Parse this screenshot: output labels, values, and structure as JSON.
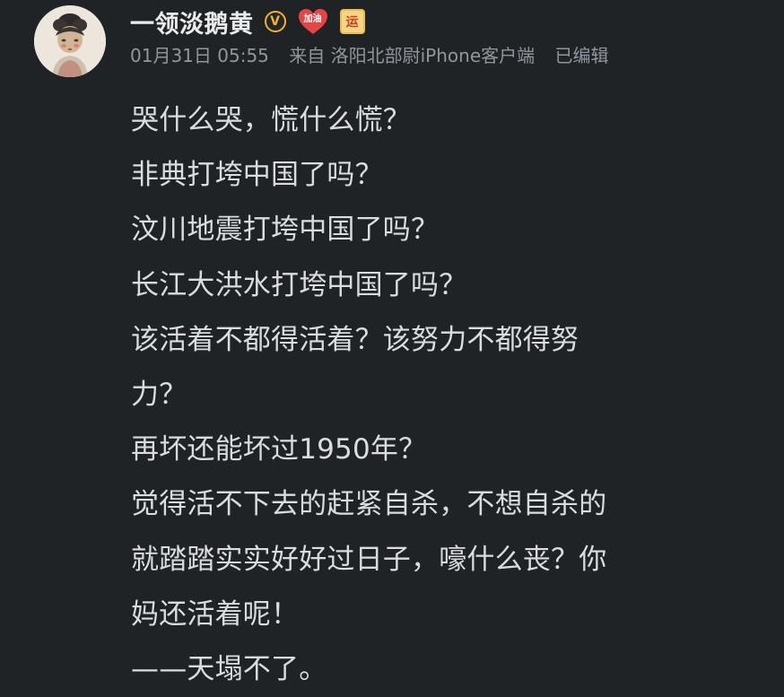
{
  "post": {
    "author": {
      "name": "一领淡鹅黄",
      "badges": [
        {
          "name": "verified-badge-icon",
          "text": "V"
        },
        {
          "name": "jiayou-badge-icon",
          "text": "加油"
        },
        {
          "name": "yun-badge-icon",
          "text": "运"
        }
      ]
    },
    "meta": {
      "datetime": "01月31日 05:55",
      "source": "来自 洛阳北部尉iPhone客户端",
      "edited": "已编辑"
    },
    "lines": [
      "哭什么哭，慌什么慌？",
      "非典打垮中国了吗？",
      "汶川地震打垮中国了吗？",
      "长江大洪水打垮中国了吗？",
      "该活着不都得活着？该努力不都得努",
      "力？",
      "再坏还能坏过1950年？",
      "觉得活不下去的赶紧自杀，不想自杀的",
      "就踏踏实实好好过日子，嚎什么丧？你",
      "妈还活着呢！",
      "——天塌不了。"
    ]
  },
  "colors": {
    "background": "#1f2326",
    "text_primary": "#dadcdf",
    "text_meta": "#8f979e",
    "verified_gold": "#f2b12d",
    "heart_red": "#e64545"
  }
}
